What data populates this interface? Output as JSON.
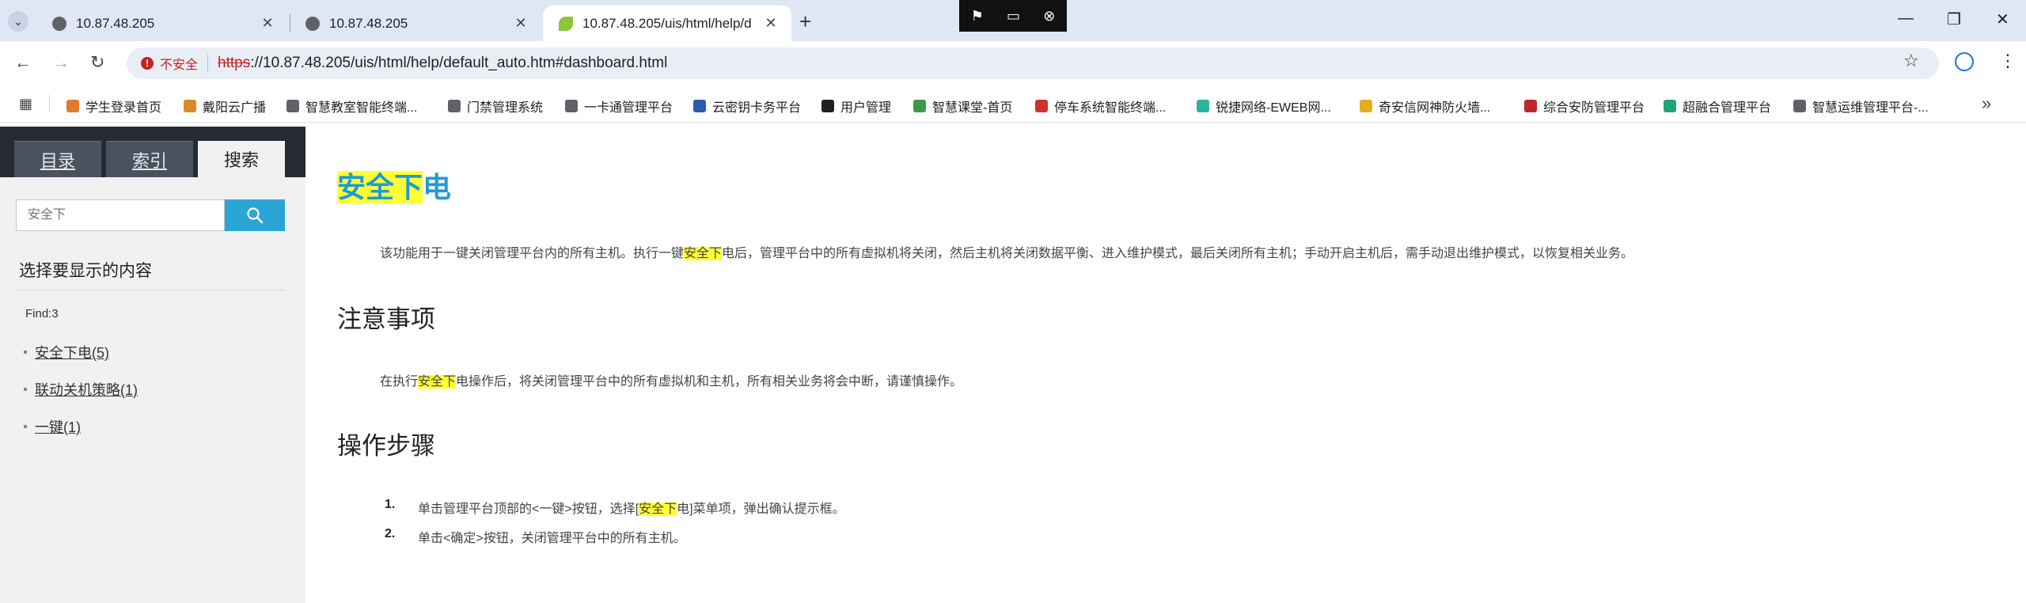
{
  "browser": {
    "tabs": [
      {
        "title": "10.87.48.205",
        "active": false
      },
      {
        "title": "10.87.48.205",
        "active": false
      },
      {
        "title": "10.87.48.205/uis/html/help/d",
        "active": true
      }
    ],
    "address": {
      "security_label": "不安全",
      "scheme": "https",
      "rest": "://10.87.48.205/uis/html/help/default_auto.htm#dashboard.html"
    },
    "bookmarks": [
      {
        "label": "学生登录首页",
        "color": "#e07a2f"
      },
      {
        "label": "戴阳云广播",
        "color": "#d98a2b"
      },
      {
        "label": "智慧教室智能终端...",
        "color": "#5f6368"
      },
      {
        "label": "门禁管理系统",
        "color": "#5f6368"
      },
      {
        "label": "一卡通管理平台",
        "color": "#5f6368"
      },
      {
        "label": "云密钥卡务平台",
        "color": "#2a5db0"
      },
      {
        "label": "用户管理",
        "color": "#202124"
      },
      {
        "label": "智慧课堂-首页",
        "color": "#3a9a4a"
      },
      {
        "label": "停车系统智能终端...",
        "color": "#d03030"
      },
      {
        "label": "锐捷网络-EWEB网...",
        "color": "#2ab3a0"
      },
      {
        "label": "奇安信网神防火墙...",
        "color": "#e0b020"
      },
      {
        "label": "综合安防管理平台",
        "color": "#c0262d"
      },
      {
        "label": "超融合管理平台",
        "color": "#1fa37a"
      },
      {
        "label": "智慧运维管理平台-...",
        "color": "#5f6368"
      }
    ]
  },
  "sidebar": {
    "tabs": [
      "目录",
      "索引",
      "搜索"
    ],
    "search": {
      "value": "安全下",
      "placeholder": "安全下"
    },
    "heading": "选择要显示的内容",
    "find": "Find:3",
    "results": [
      "安全下电(5)",
      "联动关机策略(1)",
      "一键(1)"
    ]
  },
  "doc": {
    "title_hl": "安全下",
    "title_rest": "电",
    "intro": {
      "pre": "该功能用于一键关闭管理平台内的所有主机。执行一键",
      "hl": "安全下",
      "post": "电后，管理平台中的所有虚拟机将关闭，然后主机将关闭数据平衡、进入维护模式，最后关闭所有主机；手动开启主机后，需手动退出维护模式，以恢复相关业务。"
    },
    "notes_heading": "注意事项",
    "notes": {
      "pre": "在执行",
      "hl": "安全下",
      "post": "电操作后，将关闭管理平台中的所有虚拟机和主机，所有相关业务将会中断，请谨慎操作。"
    },
    "steps_heading": "操作步骤",
    "steps": [
      {
        "num": "1.",
        "pre": "单击管理平台顶部的<一键>按钮，选择[",
        "hl": "安全下",
        "post": "电]菜单项，弹出确认提示框。"
      },
      {
        "num": "2.",
        "text": "单击<确定>按钮，关闭管理平台中的所有主机。"
      }
    ]
  }
}
